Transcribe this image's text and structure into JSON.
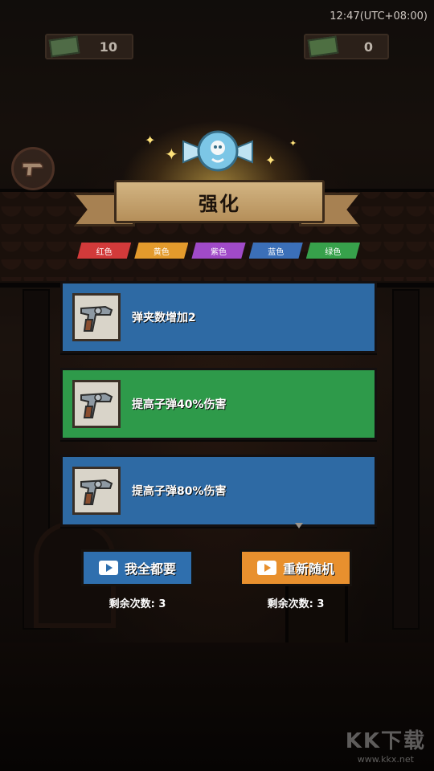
{
  "status_bar": {
    "time": "12:47(UTC+08:00)"
  },
  "counters": {
    "left_value": "10",
    "right_value": "0"
  },
  "popup": {
    "title": "强化",
    "tags": [
      {
        "label": "红色",
        "color": "#d23a3a"
      },
      {
        "label": "黄色",
        "color": "#e39a2c"
      },
      {
        "label": "紫色",
        "color": "#a04ac8"
      },
      {
        "label": "蓝色",
        "color": "#3b6fb8"
      },
      {
        "label": "绿色",
        "color": "#37a14b"
      }
    ],
    "options": [
      {
        "text": "弹夹数增加2",
        "color": "blue",
        "icon": "revolver-icon"
      },
      {
        "text": "提高子弹40%伤害",
        "color": "green",
        "icon": "revolver-icon"
      },
      {
        "text": "提高子弹80%伤害",
        "color": "blue",
        "icon": "revolver-icon"
      }
    ],
    "buttons": {
      "take_all": {
        "label": "我全都要",
        "remaining": "剩余次数: 3",
        "color": "#2f6fae"
      },
      "reroll": {
        "label": "重新随机",
        "remaining": "剩余次数: 3",
        "color": "#e8902e"
      }
    }
  },
  "watermark": {
    "logo": "KK下载",
    "url": "www.kkx.net"
  }
}
